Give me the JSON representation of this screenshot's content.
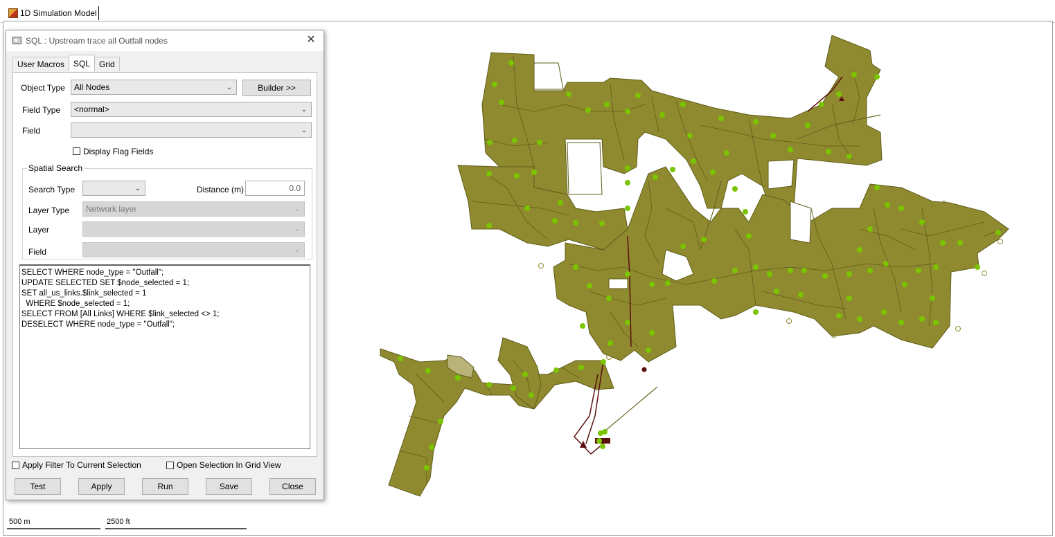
{
  "app": {
    "title": "1D Simulation Model"
  },
  "dialog": {
    "title": "SQL : Upstream trace all Outfall nodes",
    "close_glyph": "✕",
    "tabs": [
      {
        "label": "User Macros",
        "active": false
      },
      {
        "label": "SQL",
        "active": true
      },
      {
        "label": "Grid",
        "active": false
      }
    ],
    "object_type": {
      "label": "Object Type",
      "value": "All Nodes"
    },
    "builder_button": "Builder >>",
    "field_type": {
      "label": "Field Type",
      "value": "<normal>"
    },
    "field": {
      "label": "Field",
      "value": ""
    },
    "display_flag_fields": {
      "label": "Display Flag Fields",
      "checked": false
    },
    "spatial_search": {
      "title": "Spatial Search",
      "search_type": {
        "label": "Search Type",
        "value": ""
      },
      "distance": {
        "label": "Distance (m)",
        "value": "0.0"
      },
      "layer_type": {
        "label": "Layer Type",
        "value": "Network layer"
      },
      "layer": {
        "label": "Layer",
        "value": ""
      },
      "field": {
        "label": "Field",
        "value": ""
      }
    },
    "sql_text": "SELECT WHERE node_type = \"Outfall\";\nUPDATE SELECTED SET $node_selected = 1;\nSET all_us_links.$link_selected = 1\n  WHERE $node_selected = 1;\nSELECT FROM [All Links] WHERE $link_selected <> 1;\nDESELECT WHERE node_type = \"Outfall\";",
    "apply_filter": {
      "label": "Apply Filter To Current Selection",
      "checked": false
    },
    "open_in_grid": {
      "label": "Open Selection In Grid View",
      "checked": false
    },
    "buttons": {
      "test": "Test",
      "apply": "Apply",
      "run": "Run",
      "save": "Save",
      "close": "Close"
    }
  },
  "map": {
    "scale_metric": "500 m",
    "scale_imperial": "2500 ft",
    "colors": {
      "subcatchment_fill": "#8f8a2f",
      "subcatchment_edge": "#5f5c1a",
      "node": "#7ac400",
      "link": "#5f5c1a",
      "selected_link": "#5a0f0f",
      "outfall": "#8f8a2f"
    }
  }
}
